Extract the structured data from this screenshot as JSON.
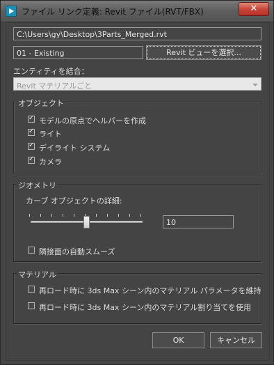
{
  "window": {
    "title": "ファイル リンク定義: Revit ファイル(RVT/FBX)",
    "close_label": "✕"
  },
  "file_path": "C:\\Users\\gy\\Desktop\\3Parts_Merged.rvt",
  "view": {
    "value": "01 - Existing",
    "select_button": "Revit ビューを選択..."
  },
  "combine": {
    "label": "エンティティを結合：",
    "dropdown_value": "Revit マテリアルごと"
  },
  "objects": {
    "title": "オブジェクト",
    "options": [
      {
        "label": "モデルの原点でヘルパーを作成",
        "checked": true
      },
      {
        "label": "ライト",
        "checked": true
      },
      {
        "label": "デイライト システム",
        "checked": true
      },
      {
        "label": "カメラ",
        "checked": true
      }
    ]
  },
  "geometry": {
    "title": "ジオメトリ",
    "curve_detail_label": "カーブ オブジェクトの詳細:",
    "curve_detail_value": "10",
    "slider_fraction": 0.5,
    "auto_smooth_label": "隣接面の自動スムーズ",
    "auto_smooth_checked": false
  },
  "material": {
    "title": "マテリアル",
    "options": [
      {
        "label": "再ロード時に 3ds Max シーン内のマテリアル パラメータを維持",
        "checked": false
      },
      {
        "label": "再ロード時に 3ds Max シーン内のマテリアル割り当てを使用",
        "checked": false
      }
    ]
  },
  "buttons": {
    "ok": "OK",
    "cancel": "キャンセル"
  }
}
